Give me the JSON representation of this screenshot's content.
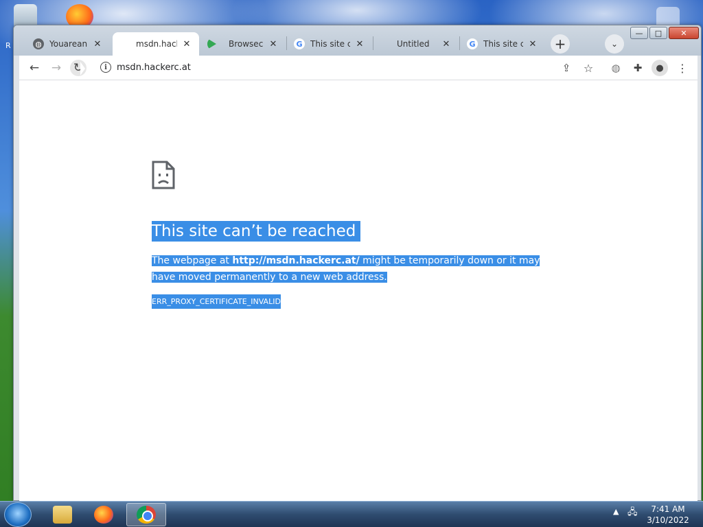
{
  "desktop": {
    "recycle_bin_icon": "recycle-bin-icon",
    "firefox_icon": "firefox-icon",
    "partial_label": "R"
  },
  "browser": {
    "tabs": [
      {
        "label": "Youareanid",
        "favicon": "globe-icon",
        "active": false
      },
      {
        "label": "msdn.hacke",
        "favicon": "",
        "active": true
      },
      {
        "label": "Browsec: C",
        "favicon": "play-store-icon",
        "active": false
      },
      {
        "label": "This site ca",
        "favicon": "google-icon",
        "active": false
      },
      {
        "label": "Untitled",
        "favicon": "",
        "active": false
      },
      {
        "label": "This site ca",
        "favicon": "google-icon",
        "active": false
      }
    ],
    "new_tab_symbol": "+",
    "tab_search_symbol": "⌄",
    "window_controls": {
      "minimize": "—",
      "maximize": "□",
      "close": "✕"
    },
    "url": "msdn.hackerc.at"
  },
  "error_page": {
    "title": "This site can’t be reached",
    "body_prefix": "The webpage at ",
    "body_url": "http://msdn.hackerc.at/",
    "body_suffix": " might be temporarily down or it may have moved permanently to a new web address.",
    "error_code": "ERR_PROXY_CERTIFICATE_INVALID",
    "selection_color": "#3a8ee6"
  },
  "taskbar": {
    "time": "7:41 AM",
    "date": "3/10/2022",
    "items": [
      "file-explorer",
      "firefox",
      "chrome"
    ],
    "active_item": "chrome"
  }
}
